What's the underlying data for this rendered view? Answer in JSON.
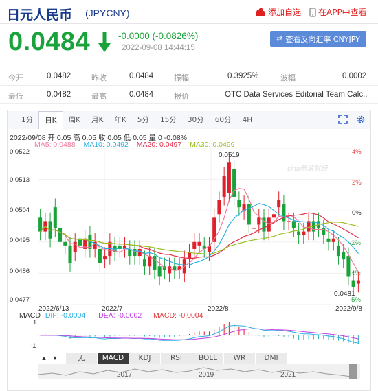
{
  "header": {
    "title": "日元人民币",
    "code": "(JPYCNY)",
    "add_watch": "添加自选",
    "app_view": "在APP中查看"
  },
  "quote": {
    "price": "0.0484",
    "change": "-0.0000 (-0.0826%)",
    "datetime": "2022-09-08 14:44:15",
    "reverse_button": "查看反向汇率 CNYJPY"
  },
  "stats": {
    "row1": [
      {
        "label": "今开",
        "value": "0.0482"
      },
      {
        "label": "昨收",
        "value": "0.0484"
      },
      {
        "label": "振幅",
        "value": "0.3925%"
      },
      {
        "label": "波幅",
        "value": "0.0002"
      }
    ],
    "row2": [
      {
        "label": "最低",
        "value": "0.0482"
      },
      {
        "label": "最高",
        "value": "0.0484"
      },
      {
        "label": "报价",
        "value": "OTC Data Services Editorial Team Calc..."
      }
    ]
  },
  "periods": [
    "1分",
    "日K",
    "周K",
    "月K",
    "年K",
    "5分",
    "15分",
    "30分",
    "60分",
    "4H"
  ],
  "active_period": "日K",
  "ohlc_info": "2022/09/08 开 0.05 高 0.05 收 0.05 低 0.05 量 0 -0.08%",
  "ma": [
    {
      "label": "MA5: 0.0488",
      "color": "#f07a9a"
    },
    {
      "label": "MA10: 0.0492",
      "color": "#2ab0e0"
    },
    {
      "label": "MA20: 0.0497",
      "color": "#e0304a"
    },
    {
      "label": "MA30: 0.0499",
      "color": "#9ac020"
    }
  ],
  "y_ticks": [
    "0.0522",
    "0.0513",
    "0.0504",
    "0.0495",
    "0.0486",
    "0.0477"
  ],
  "pct_ticks": [
    "4%",
    "2%",
    "0%",
    "-2%",
    "-4%",
    "-5%"
  ],
  "x_ticks": [
    "2022/6/13",
    "2022/7",
    "2022/8",
    "2022/9/8"
  ],
  "annot_high": "0.0519",
  "annot_low": "0.0481",
  "watermark": "sina新浪财经",
  "macd": {
    "label": "MACD",
    "dif": "DIF: -0.0004",
    "dea": "DEA: -0.0002",
    "macd": "MACD: -0.0004",
    "ticks": [
      "1",
      "-1"
    ]
  },
  "nav": {
    "up": "▲",
    "down": "▼"
  },
  "indicators": [
    "无",
    "MACD",
    "KDJ",
    "RSI",
    "BOLL",
    "WR",
    "DMI"
  ],
  "active_indicator": "MACD",
  "overview_years": [
    "2017",
    "2019",
    "2021"
  ],
  "colors": {
    "up": "#e0202a",
    "down": "#1aa33a",
    "accent": "#5b8ad8"
  },
  "chart_data": {
    "type": "candlestick",
    "title": "日元人民币 (JPYCNY)",
    "x_range": [
      "2022/6/13",
      "2022/9/8"
    ],
    "ylim": [
      0.0477,
      0.0522
    ],
    "y_right_percent": [
      "4%",
      "2%",
      "0%",
      "-2%",
      "-4%",
      "-5%"
    ],
    "candles": [
      [
        0.0502,
        0.0498
      ],
      [
        0.0498,
        0.0501
      ],
      [
        0.0501,
        0.0496
      ],
      [
        0.0505,
        0.0499
      ],
      [
        0.0499,
        0.0495
      ],
      [
        0.0495,
        0.0494
      ],
      [
        0.0494,
        0.0489
      ],
      [
        0.0492,
        0.0495
      ],
      [
        0.0496,
        0.0494
      ],
      [
        0.0493,
        0.0496
      ],
      [
        0.0497,
        0.0493
      ],
      [
        0.0493,
        0.0495
      ],
      [
        0.0493,
        0.0489
      ],
      [
        0.049,
        0.0491
      ],
      [
        0.0491,
        0.0495
      ],
      [
        0.0494,
        0.0492
      ],
      [
        0.0494,
        0.0493
      ],
      [
        0.0493,
        0.0494
      ],
      [
        0.0493,
        0.0491
      ],
      [
        0.0493,
        0.0491
      ],
      [
        0.0491,
        0.0493
      ],
      [
        0.049,
        0.0488
      ],
      [
        0.0488,
        0.0491
      ],
      [
        0.0491,
        0.0487
      ],
      [
        0.0488,
        0.0485
      ],
      [
        0.0488,
        0.0487
      ],
      [
        0.0486,
        0.0488
      ],
      [
        0.0488,
        0.0487
      ],
      [
        0.0487,
        0.0488
      ],
      [
        0.0486,
        0.049
      ],
      [
        0.049,
        0.0492
      ],
      [
        0.0493,
        0.0495
      ],
      [
        0.0494,
        0.0495
      ],
      [
        0.0494,
        0.0493
      ],
      [
        0.0492,
        0.0494
      ],
      [
        0.0495,
        0.0502
      ],
      [
        0.0503,
        0.0507
      ],
      [
        0.0508,
        0.0514
      ],
      [
        0.0509,
        0.0518
      ],
      [
        0.0516,
        0.0508
      ],
      [
        0.0507,
        0.0505
      ],
      [
        0.0504,
        0.0506
      ],
      [
        0.0506,
        0.05
      ],
      [
        0.0499,
        0.0499
      ],
      [
        0.05,
        0.0502
      ],
      [
        0.0502,
        0.0498
      ],
      [
        0.0498,
        0.0502
      ],
      [
        0.0502,
        0.0503
      ],
      [
        0.0505,
        0.0507
      ],
      [
        0.0506,
        0.0501
      ],
      [
        0.0501,
        0.0501
      ],
      [
        0.0501,
        0.0499
      ],
      [
        0.0498,
        0.0497
      ],
      [
        0.0497,
        0.0498
      ],
      [
        0.0498,
        0.0501
      ],
      [
        0.0501,
        0.0498
      ],
      [
        0.0501,
        0.0499
      ],
      [
        0.0499,
        0.0497
      ],
      [
        0.0496,
        0.0495
      ],
      [
        0.0495,
        0.0496
      ],
      [
        0.0494,
        0.0491
      ],
      [
        0.0492,
        0.049
      ],
      [
        0.0491,
        0.0485
      ],
      [
        0.0484,
        0.0482
      ],
      [
        0.0483,
        0.0484
      ]
    ],
    "candle_format": [
      "open",
      "close"
    ],
    "high": 0.0519,
    "low": 0.0481
  }
}
